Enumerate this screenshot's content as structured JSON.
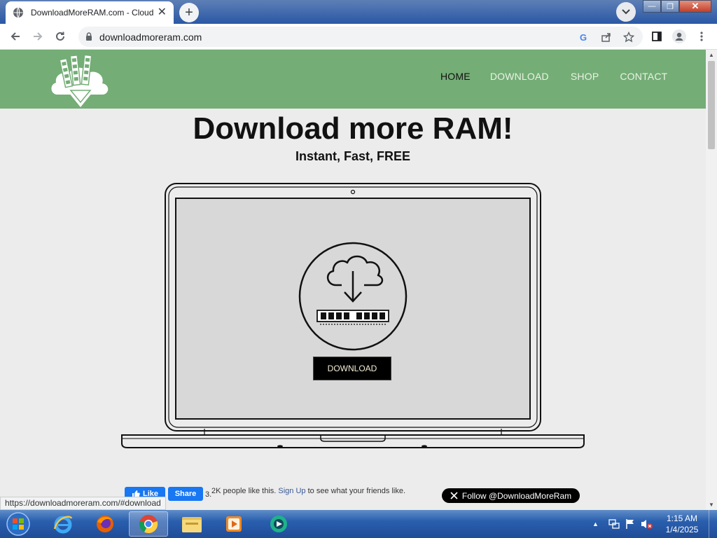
{
  "browser": {
    "tab_title": "DownloadMoreRAM.com - Cloud",
    "tab_close": "✕",
    "new_tab": "+",
    "url": "downloadmoreram.com",
    "status_url": "https://downloadmoreram.com/#download",
    "window_controls": {
      "minimize": "—",
      "maximize": "❐",
      "close": "✕"
    }
  },
  "site": {
    "nav": [
      {
        "label": "HOME",
        "active": true
      },
      {
        "label": "DOWNLOAD",
        "active": false
      },
      {
        "label": "SHOP",
        "active": false
      },
      {
        "label": "CONTACT",
        "active": false
      }
    ],
    "title": "Download more RAM!",
    "subtitle": "Instant, Fast, FREE",
    "download_button": "DOWNLOAD"
  },
  "social": {
    "like_label": "Like",
    "share_label": "Share",
    "count": "3.",
    "like_text_prefix": "2K people like this.",
    "signup_link": "Sign Up",
    "like_text_suffix": "to see what your friends like.",
    "x_follow": "Follow @DownloadMoreRam"
  },
  "taskbar": {
    "apps": [
      "internet-explorer",
      "firefox",
      "chrome",
      "file-explorer",
      "media-player",
      "streaming-app"
    ],
    "time": "1:15 AM",
    "date": "1/4/2025"
  },
  "colors": {
    "header_green": "#74ad76",
    "nav_text": "#e9f4e4",
    "taskbar_blue": "#2a5fae"
  }
}
